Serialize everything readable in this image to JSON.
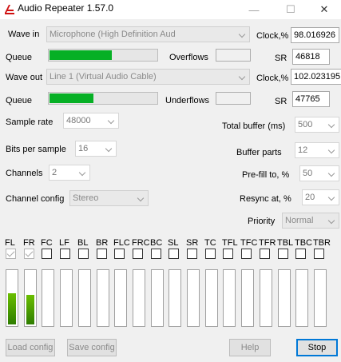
{
  "window": {
    "title": "Audio Repeater 1.57.0",
    "min_label": "—",
    "max_label": "☐",
    "close_label": "✕"
  },
  "wave_in": {
    "label": "Wave in",
    "device": "Microphone (High Definition Aud",
    "clock_label": "Clock,%",
    "clock_value": "98.016926"
  },
  "queue_in": {
    "label": "Queue",
    "level_fraction": 0.58,
    "overflows_label": "Overflows",
    "sr_label": "SR",
    "sr_value": "46818"
  },
  "wave_out": {
    "label": "Wave out",
    "device": "Line 1 (Virtual Audio Cable)",
    "clock_label": "Clock,%",
    "clock_value": "102.023195"
  },
  "queue_out": {
    "label": "Queue",
    "level_fraction": 0.41,
    "underflows_label": "Underflows",
    "sr_label": "SR",
    "sr_value": "47765"
  },
  "settings": {
    "sample_rate": {
      "label": "Sample rate",
      "value": "48000"
    },
    "bits_per_sample": {
      "label": "Bits per sample",
      "value": "16"
    },
    "channels": {
      "label": "Channels",
      "value": "2"
    },
    "channel_config": {
      "label": "Channel config",
      "value": "Stereo"
    },
    "total_buffer": {
      "label": "Total buffer (ms)",
      "value": "500"
    },
    "buffer_parts": {
      "label": "Buffer parts",
      "value": "12"
    },
    "prefill": {
      "label": "Pre-fill to, %",
      "value": "50"
    },
    "resync": {
      "label": "Resync at, %",
      "value": "20"
    },
    "priority": {
      "label": "Priority",
      "value": "Normal"
    }
  },
  "speakers": [
    {
      "label": "FL",
      "checked": true,
      "level_fraction": 0.57
    },
    {
      "label": "FR",
      "checked": true,
      "level_fraction": 0.55
    },
    {
      "label": "FC",
      "checked": false,
      "level_fraction": 0
    },
    {
      "label": "LF",
      "checked": false,
      "level_fraction": 0
    },
    {
      "label": "BL",
      "checked": false,
      "level_fraction": 0
    },
    {
      "label": "BR",
      "checked": false,
      "level_fraction": 0
    },
    {
      "label": "FLC",
      "checked": false,
      "level_fraction": 0
    },
    {
      "label": "FRC",
      "checked": false,
      "level_fraction": 0
    },
    {
      "label": "BC",
      "checked": false,
      "level_fraction": 0
    },
    {
      "label": "SL",
      "checked": false,
      "level_fraction": 0
    },
    {
      "label": "SR",
      "checked": false,
      "level_fraction": 0
    },
    {
      "label": "TC",
      "checked": false,
      "level_fraction": 0
    },
    {
      "label": "TFL",
      "checked": false,
      "level_fraction": 0
    },
    {
      "label": "TFC",
      "checked": false,
      "level_fraction": 0
    },
    {
      "label": "TFR",
      "checked": false,
      "level_fraction": 0
    },
    {
      "label": "TBL",
      "checked": false,
      "level_fraction": 0
    },
    {
      "label": "TBC",
      "checked": false,
      "level_fraction": 0
    },
    {
      "label": "TBR",
      "checked": false,
      "level_fraction": 0
    }
  ],
  "buttons": {
    "load": "Load config",
    "save": "Save config",
    "help": "Help",
    "stop": "Stop"
  },
  "colors": {
    "queue_fill": "#06b025",
    "meter_top": "#6bbf00",
    "meter_bottom": "#2e7d00",
    "stop_border": "#0078d7"
  }
}
